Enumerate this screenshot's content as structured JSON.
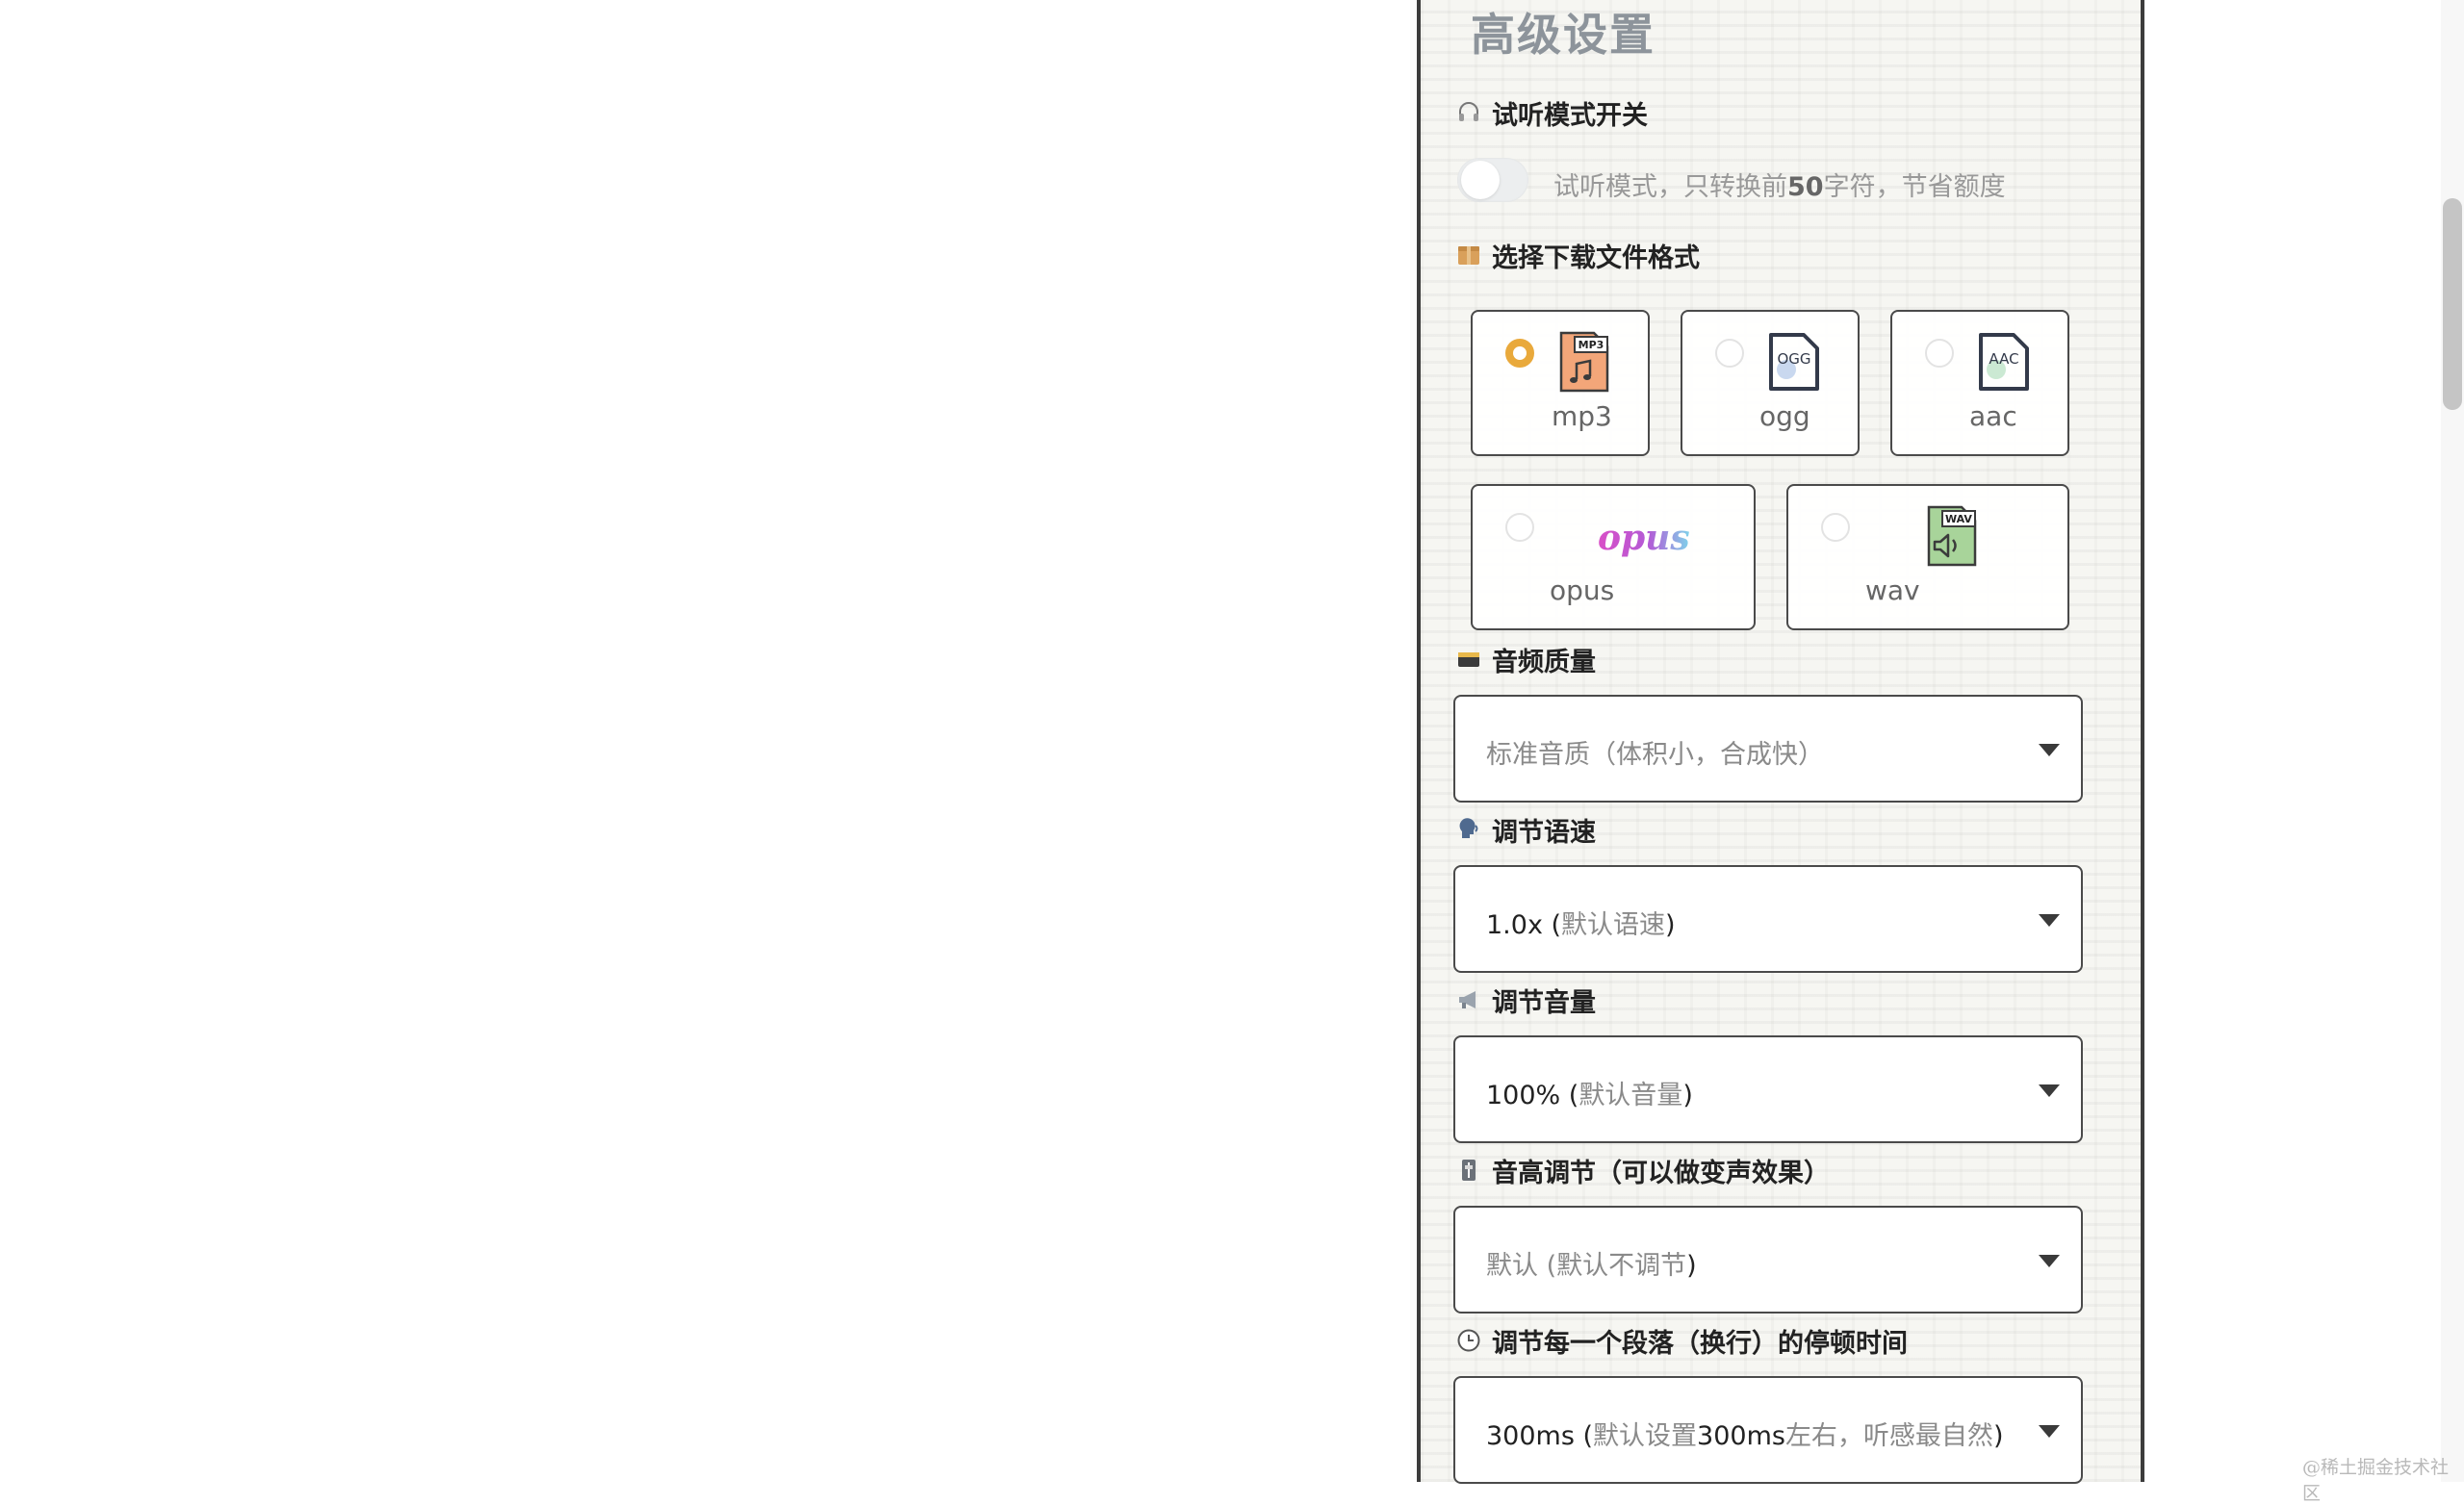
{
  "panel": {
    "title": "高级设置"
  },
  "preview": {
    "label": "试听模式开关",
    "toggle_on": false,
    "text_before": "试听模式，只转换前",
    "text_bold": "50",
    "text_after": "字符，节省额度"
  },
  "format": {
    "label": "选择下载文件格式",
    "selected": "mp3",
    "options": [
      {
        "label": "mp3",
        "icon": "mp3-file-icon",
        "icon_text": "MP3"
      },
      {
        "label": "ogg",
        "icon": "ogg-file-icon",
        "icon_text": "OGG"
      },
      {
        "label": "aac",
        "icon": "aac-file-icon",
        "icon_text": "AAC"
      },
      {
        "label": "opus",
        "icon": "opus-logo-icon",
        "icon_text": "opus"
      },
      {
        "label": "wav",
        "icon": "wav-file-icon",
        "icon_text": "WAV"
      }
    ]
  },
  "quality": {
    "label": "音频质量",
    "value": "标准音质（体积小，合成快）"
  },
  "speed": {
    "label": "调节语速",
    "value_main": "1.0x (",
    "value_muted": "默认语速",
    "value_end": ")"
  },
  "volume": {
    "label": "调节音量",
    "value_main": "100% (",
    "value_muted": "默认音量",
    "value_end": ")"
  },
  "pitch": {
    "label": "音高调节（可以做变声效果）",
    "value_main": "默认 (",
    "value_muted": "默认不调节",
    "value_end": ")"
  },
  "pause": {
    "label": "调节每一个段落（换行）的停顿时间",
    "value_main": "300ms (",
    "value_muted1": "默认设置",
    "value_main2": "300ms",
    "value_muted2": "左右，听感最自然",
    "value_end": ")"
  },
  "watermark": "@稀土掘金技术社区",
  "colors": {
    "accent_radio": "#e9a93b",
    "border": "#4a4a4a",
    "title_gray": "#8d949b"
  }
}
